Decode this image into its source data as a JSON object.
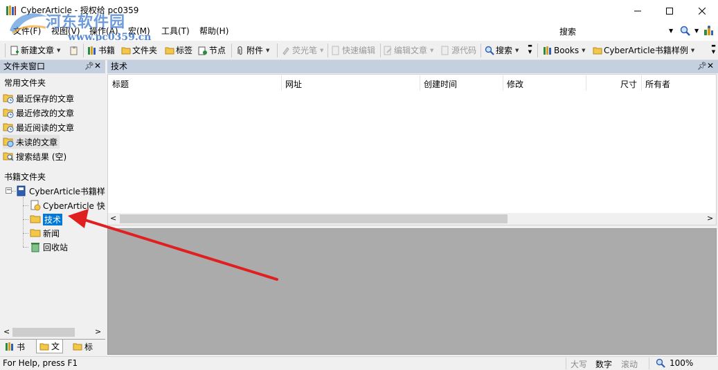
{
  "window": {
    "title": "CyberArticle - 授权给 pc0359"
  },
  "watermark": {
    "name": "河东软件园",
    "url": "www.pc0359.cn"
  },
  "menu": {
    "items": [
      "文件(F)",
      "视图(V)",
      "操作(A)",
      "宏(M)",
      "工具(T)",
      "帮助(H)"
    ]
  },
  "search": {
    "placeholder": "搜索"
  },
  "toolbar": {
    "new_article": "新建文章",
    "books": "书籍",
    "folder": "文件夹",
    "tag": "标签",
    "node": "节点",
    "attachment": "附件",
    "highlighter": "荧光笔",
    "quick_edit": "快速编辑",
    "edit_article": "编辑文章",
    "source_code": "源代码",
    "search": "搜索",
    "books_menu": "Books",
    "book_sample": "CyberArticle书籍样例"
  },
  "left_panel": {
    "title": "文件夹窗口",
    "favorites_title": "常用文件夹",
    "favorites": [
      "最近保存的文章",
      "最近修改的文章",
      "最近阅读的文章",
      "未读的文章",
      "搜索结果 (空)"
    ],
    "books_title": "书籍文件夹",
    "tree": {
      "root": "CyberArticle书籍样",
      "children": [
        "CyberArticle 快",
        "技术",
        "新闻",
        "回收站"
      ]
    },
    "tabs": [
      "书",
      "文",
      "标"
    ]
  },
  "right_panel": {
    "title": "技术",
    "columns": [
      "标题",
      "网址",
      "创建时间",
      "修改",
      "尺寸",
      "所有者"
    ]
  },
  "status": {
    "help": "For Help, press F1",
    "caps": "大写",
    "num": "数字",
    "scroll": "滚动",
    "zoom": "100%"
  },
  "colors": {
    "panel_header": "#c4cfdf",
    "selection": "#0078d7",
    "preview_bg": "#ababab",
    "annotation_arrow": "#e02020"
  }
}
